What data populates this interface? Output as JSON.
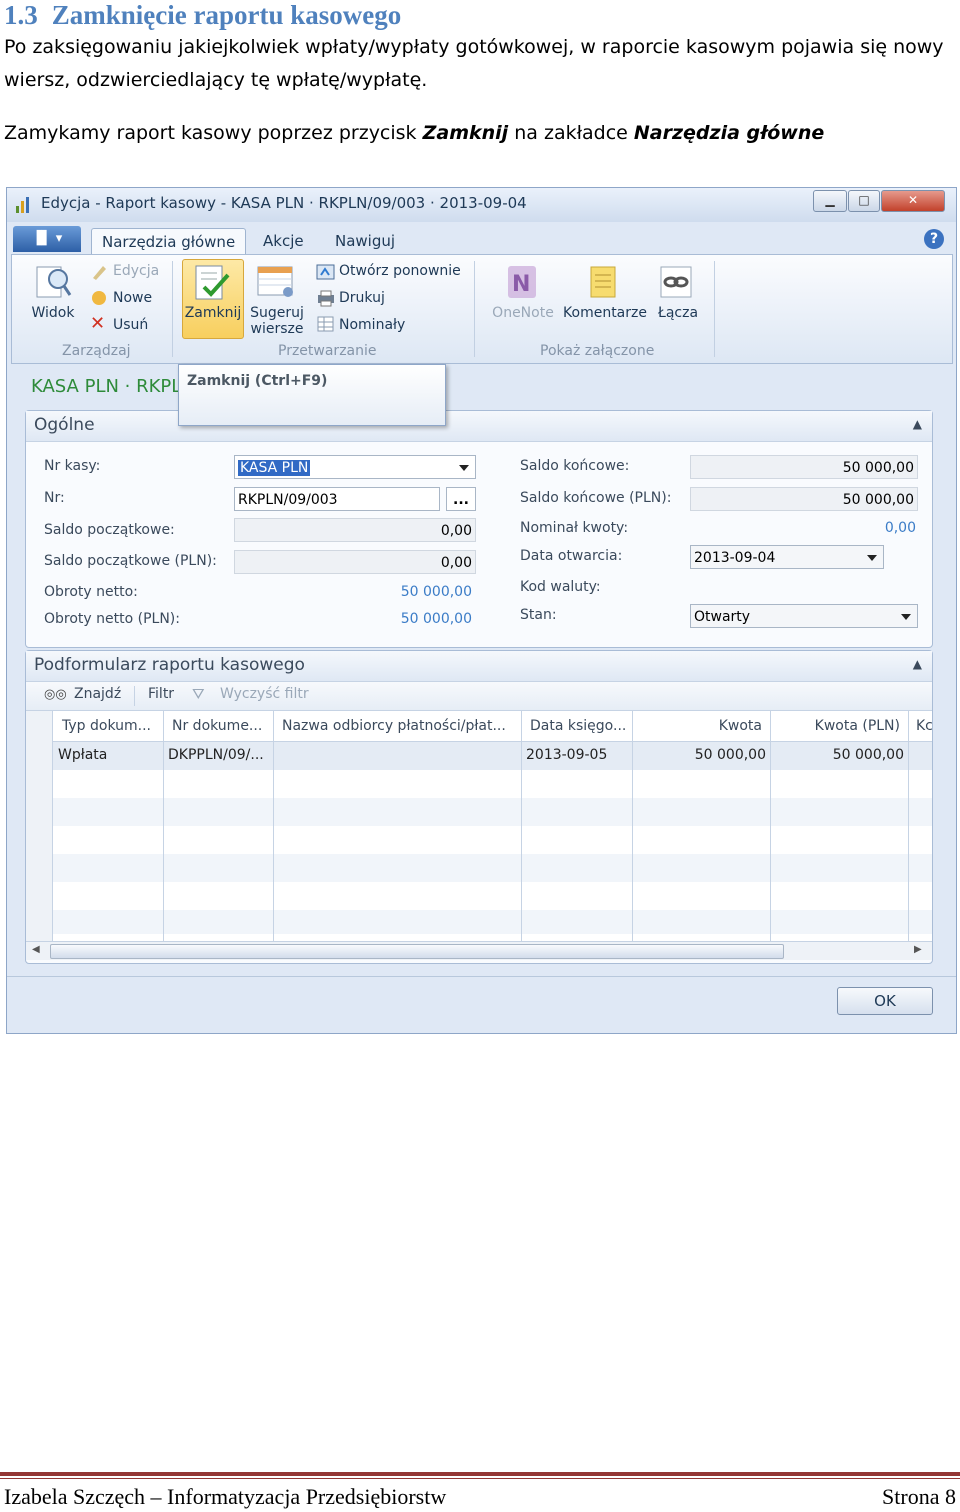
{
  "doc": {
    "heading_num": "1.3",
    "heading_text": "Zamknięcie raportu kasowego",
    "para1": "Po zaksięgowaniu jakiejkolwiek wpłaty/wypłaty gotówkowej, w raporcie kasowym pojawia się nowy wiersz, odzwierciedlający tę wpłatę/wypłatę.",
    "para2_prefix": "Zamykamy raport kasowy poprzez przycisk ",
    "para2_button": "Zamknij",
    "para2_mid": " na zakładce ",
    "para2_tab": "Narzędzia główne"
  },
  "window": {
    "title": "Edycja - Raport kasowy - KASA PLN · RKPLN/09/003 · 2013-09-04",
    "tabs": [
      "Narzędzia główne",
      "Akcje",
      "Nawiguj"
    ],
    "help": "?"
  },
  "ribbon": {
    "widok": "Widok",
    "edycja": "Edycja",
    "nowe": "Nowe",
    "usun": "Usuń",
    "group_zarzadzaj": "Zarządzaj",
    "zamknij": "Zamknij",
    "sugeruj1": "Sugeruj",
    "sugeruj2": "wiersze",
    "otworz": "Otwórz ponownie",
    "drukuj": "Drukuj",
    "nominaly": "Nominały",
    "group_przetwarzanie": "Przetwarzanie",
    "onenote": "OneNote",
    "komentarze": "Komentarze",
    "lacza": "Łącza",
    "group_pokaz": "Pokaż załączone"
  },
  "tooltip": "Zamknij (Ctrl+F9)",
  "form_title": "KASA PLN · RKPL",
  "ogolne": {
    "title": "Ogólne",
    "nr_kasy_label": "Nr kasy:",
    "nr_kasy_value": "KASA PLN",
    "nr_label": "Nr:",
    "nr_value": "RKPLN/09/003",
    "nr_btn": "...",
    "saldo_pocz_label": "Saldo początkowe:",
    "saldo_pocz_value": "0,00",
    "saldo_pocz_pln_label": "Saldo początkowe (PLN):",
    "saldo_pocz_pln_value": "0,00",
    "obroty_label": "Obroty netto:",
    "obroty_value": "50 000,00",
    "obroty_pln_label": "Obroty netto (PLN):",
    "obroty_pln_value": "50 000,00",
    "saldo_konc_label": "Saldo końcowe:",
    "saldo_konc_value": "50 000,00",
    "saldo_konc_pln_label": "Saldo końcowe (PLN):",
    "saldo_konc_pln_value": "50 000,00",
    "nominal_label": "Nominał kwoty:",
    "nominal_value": "0,00",
    "data_otw_label": "Data otwarcia:",
    "data_otw_value": "2013-09-04",
    "kod_waluty_label": "Kod waluty:",
    "stan_label": "Stan:",
    "stan_value": "Otwarty"
  },
  "podformularz": {
    "title": "Podformularz raportu kasowego",
    "znajdz": "Znajdź",
    "filtr": "Filtr",
    "wyczysc": "Wyczyść filtr",
    "columns": [
      "Typ dokum...",
      "Nr dokume...",
      "Nazwa odbiorcy płatności/płat...",
      "Data księgo...",
      "Kwota",
      "Kwota (PLN)",
      "Kc"
    ],
    "row": [
      "Wpłata",
      "DKPPLN/09/...",
      "",
      "2013-09-05",
      "50 000,00",
      "50 000,00"
    ]
  },
  "ok": "OK",
  "footer": {
    "left": "Izabela Szczęch – Informatyzacja Przedsiębiorstw",
    "right": "Strona 8"
  }
}
